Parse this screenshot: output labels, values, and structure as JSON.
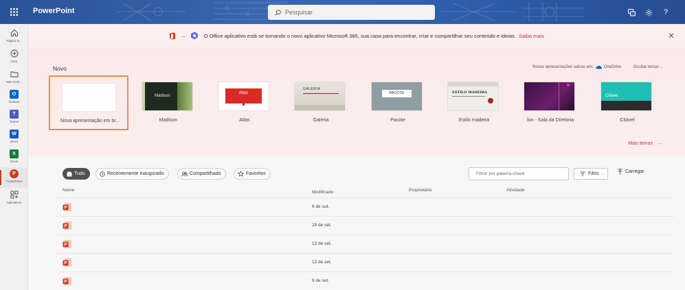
{
  "topbar": {
    "app_title": "PowerPoint",
    "search_placeholder": "Pesquisar",
    "background": "#2b579a"
  },
  "rail": {
    "items": [
      {
        "label": "Página In...",
        "icon": "home-icon"
      },
      {
        "label": "Criar",
        "icon": "plus-circle-icon"
      },
      {
        "label": "Meu Cont...",
        "icon": "folder-icon"
      },
      {
        "label": "Outlook",
        "icon": "outlook-icon",
        "letter": "O",
        "color": "#0a64c8"
      },
      {
        "label": "Teams",
        "icon": "teams-icon",
        "letter": "T",
        "color": "#5059c9"
      },
      {
        "label": "Word",
        "icon": "word-icon",
        "letter": "W",
        "color": "#185abd"
      },
      {
        "label": "Excel",
        "icon": "excel-icon",
        "letter": "X",
        "color": "#107c41"
      },
      {
        "label": "PowerPoint",
        "icon": "powerpoint-icon",
        "letter": "P",
        "color": "#c43e1c"
      },
      {
        "label": "Aplicativos",
        "icon": "apps-icon"
      }
    ]
  },
  "banner": {
    "message": "O Office aplicativo está se tornando o novo aplicativo Microsoft 365, sua casa para encontrar, criar e compartilhar seu conteúdo e ideias.",
    "link": "Saiba mais"
  },
  "new_section": {
    "title": "Novo",
    "onedrive_note": "Novas apresentações salvas em:",
    "onedrive_label": "OneDrive",
    "hide_themes": "Ocultar temas",
    "more_themes": "Mais temas",
    "templates": [
      {
        "name": "Nova apresentação em br...",
        "thumb_text": ""
      },
      {
        "name": "Madison",
        "thumb_text": "Madison"
      },
      {
        "name": "Atlas",
        "thumb_text": "Atlas"
      },
      {
        "name": "Galeria",
        "thumb_text": "GALERIA"
      },
      {
        "name": "Pacote",
        "thumb_text": "PACOTE"
      },
      {
        "name": "Estilo madeira",
        "thumb_text": "ESTILO MADEIRA"
      },
      {
        "name": "Íon - Sala da Diretoria",
        "thumb_text": ""
      },
      {
        "name": "Citável",
        "thumb_text": "Citável"
      }
    ]
  },
  "files": {
    "chips": [
      "Tudo",
      "Recentemente inaugurado",
      "Compartilhado",
      "Favoritos"
    ],
    "filter_placeholder": "Filtrar por palavra-chave",
    "filter_label": "Filtro",
    "upload_label": "Carregar",
    "columns": {
      "name": "Nome",
      "modified": "Modificado",
      "modified_sort": "↓",
      "owner": "Proprietário",
      "activity": "Atividade"
    },
    "rows": [
      {
        "modified": "6 de out."
      },
      {
        "modified": "29 de set."
      },
      {
        "modified": "12 de set."
      },
      {
        "modified": "12 de set."
      },
      {
        "modified": "9 de set."
      }
    ]
  }
}
